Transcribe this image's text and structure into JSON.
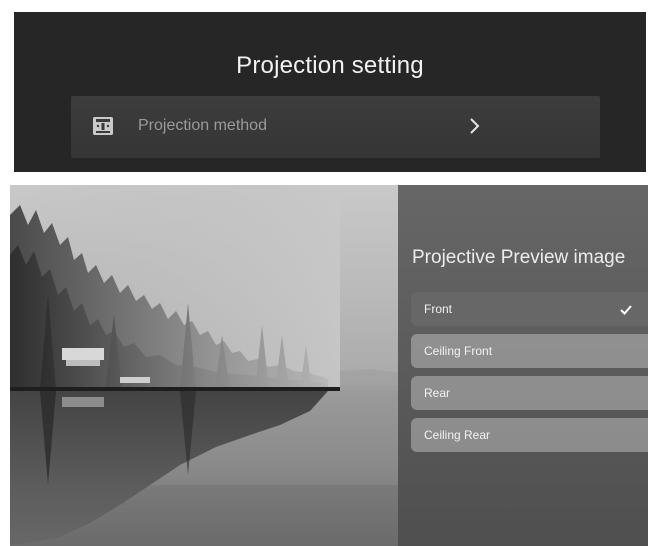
{
  "projection_setting": {
    "title": "Projection setting",
    "method_item": {
      "label": "Projection method",
      "icon": "projector-icon",
      "chevron_icon": "chevron-right-icon"
    }
  },
  "preview": {
    "title": "Projective Preview image",
    "options": [
      {
        "label": "Front",
        "selected": true,
        "check_icon": "check-icon"
      },
      {
        "label": "Ceiling Front",
        "selected": false
      },
      {
        "label": "Rear",
        "selected": false
      },
      {
        "label": "Ceiling Rear",
        "selected": false
      }
    ],
    "background_image": "foggy-lake-forest"
  },
  "colors": {
    "top_bg": "#262626",
    "row_bg": "#3a3a3a",
    "title_text": "#f2f2f2",
    "muted_text": "#9a9a9a",
    "side_panel": "#5c5c5c",
    "option_bg": "#b9b9b9"
  }
}
